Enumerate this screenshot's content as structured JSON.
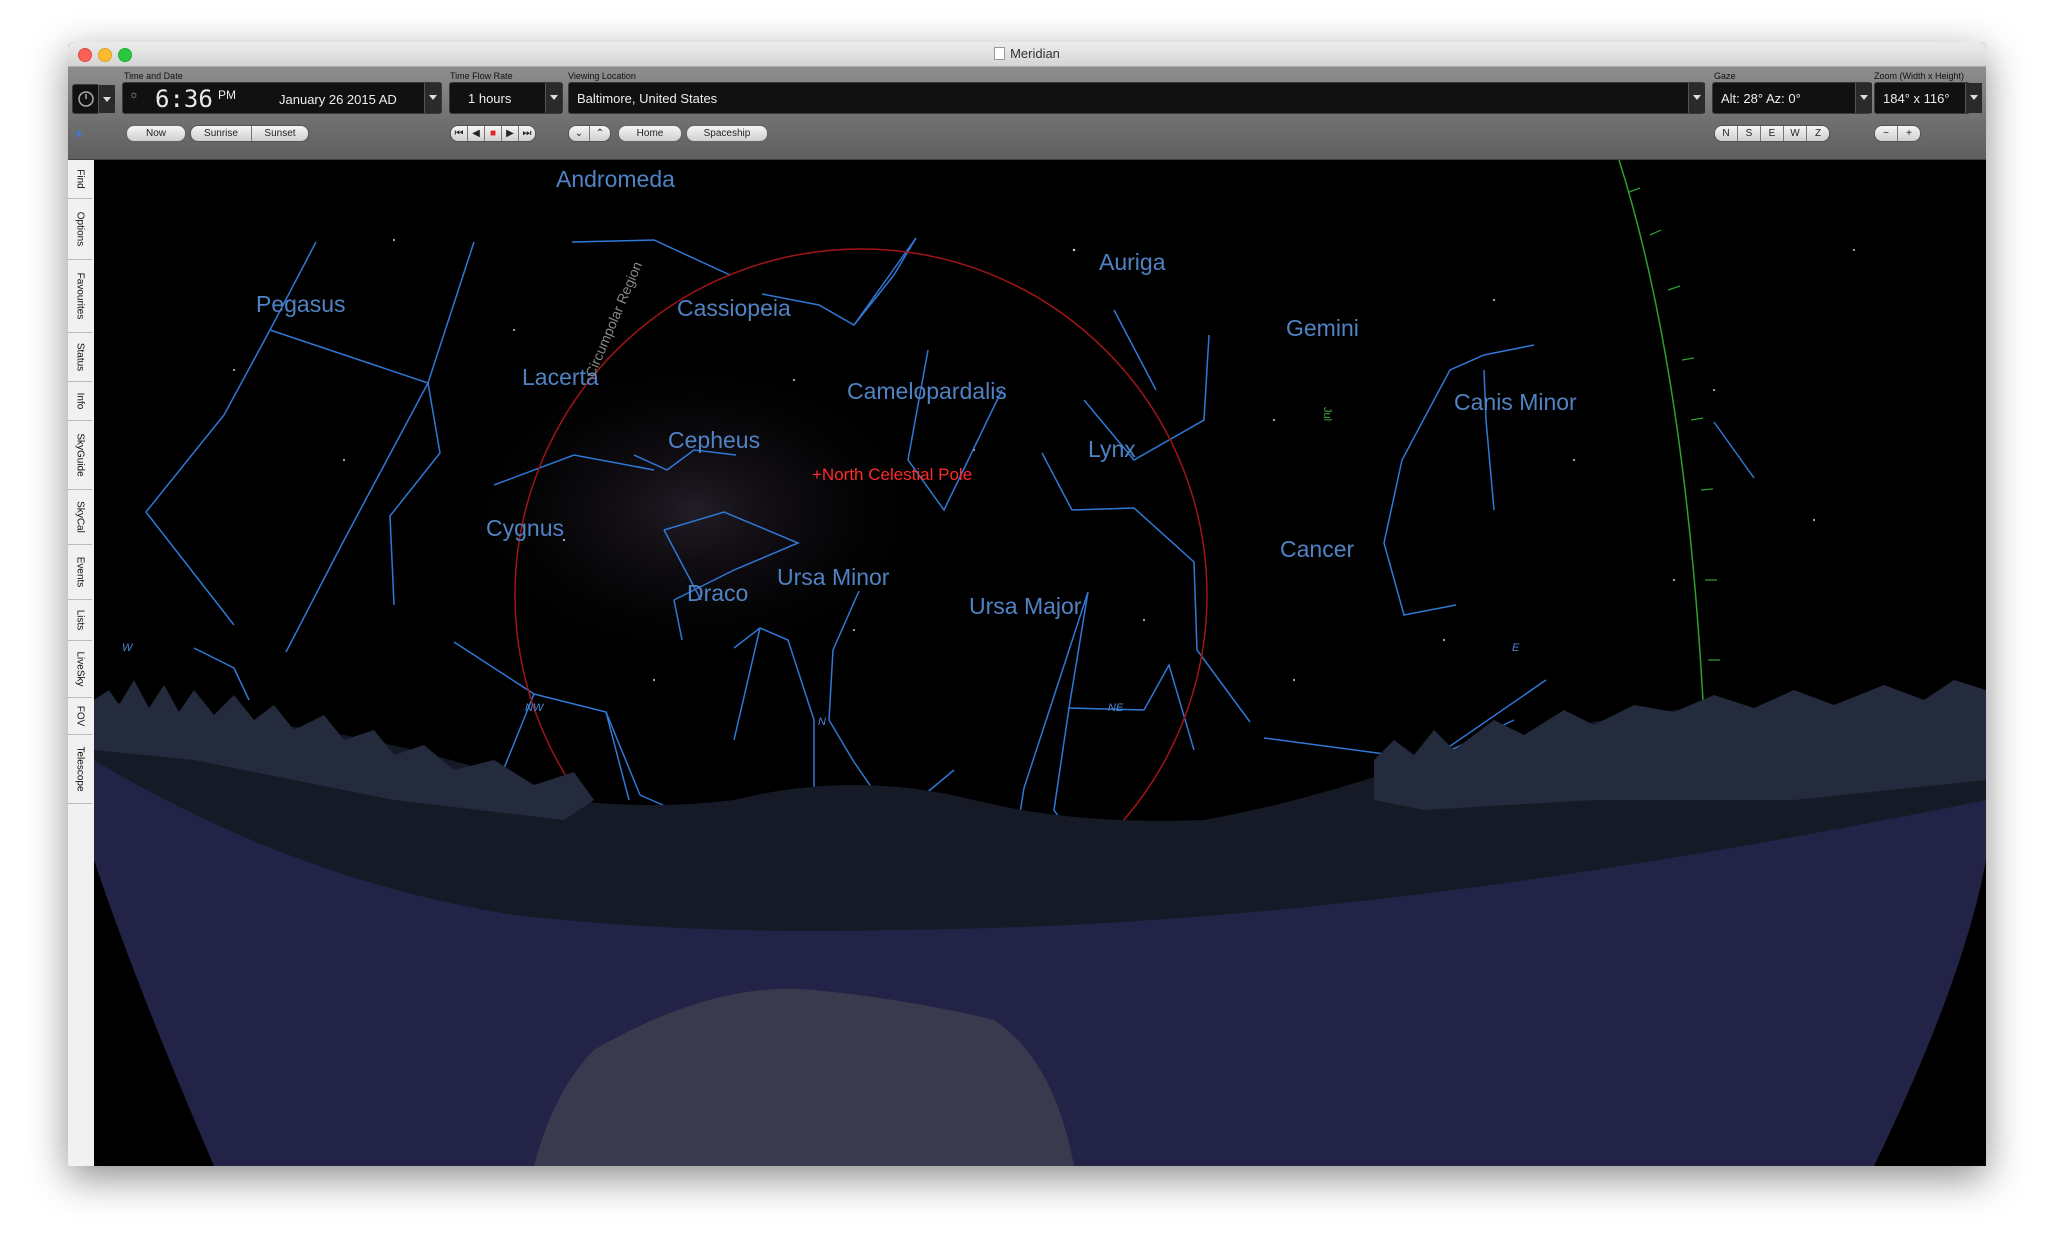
{
  "window": {
    "title": "Meridian"
  },
  "toolbar": {
    "time_label": "Time and Date",
    "time_value": "6:36",
    "ampm": "PM",
    "date_value": "January 26   2015 AD",
    "now": "Now",
    "sunrise": "Sunrise",
    "sunset": "Sunset",
    "flow_label": "Time Flow Rate",
    "flow_value": "1 hours",
    "location_label": "Viewing Location",
    "location_value": "Baltimore, United States",
    "home": "Home",
    "spaceship": "Spaceship",
    "gaze_label": "Gaze",
    "gaze_value": "Alt: 28° Az: 0°",
    "gaze_buttons": [
      "N",
      "S",
      "E",
      "W",
      "Z"
    ],
    "zoom_label": "Zoom (Width x Height)",
    "zoom_value": "184° x 116°",
    "zoom_minus": "−",
    "zoom_plus": "+"
  },
  "sidebar": {
    "tabs": [
      "Find",
      "Options",
      "Favourites",
      "Status",
      "Info",
      "SkyGuide",
      "SkyCal",
      "Events",
      "Lists",
      "LiveSky",
      "FOV",
      "Telescope"
    ]
  },
  "sky": {
    "constellations": [
      "Andromeda",
      "Pegasus",
      "Cassiopeia",
      "Auriga",
      "Gemini",
      "Lacerta",
      "Camelopardalis",
      "Cepheus",
      "Lynx",
      "Canis Minor",
      "Cygnus",
      "Cancer",
      "Ursa Minor",
      "Draco",
      "Ursa Major",
      "Cepheus"
    ],
    "pole_label": "+North Celestial Pole",
    "circumpolar_label": "Circumpolar Region",
    "ecliptic_marker": "Jul",
    "directions": [
      "W",
      "NW",
      "N",
      "NE",
      "E"
    ],
    "colors": {
      "constellation_lines": "#2f78d6",
      "pole": "#ff2a2a",
      "circumpolar": "#a01515",
      "ecliptic": "#2fa02f",
      "ground": "#232347"
    }
  }
}
